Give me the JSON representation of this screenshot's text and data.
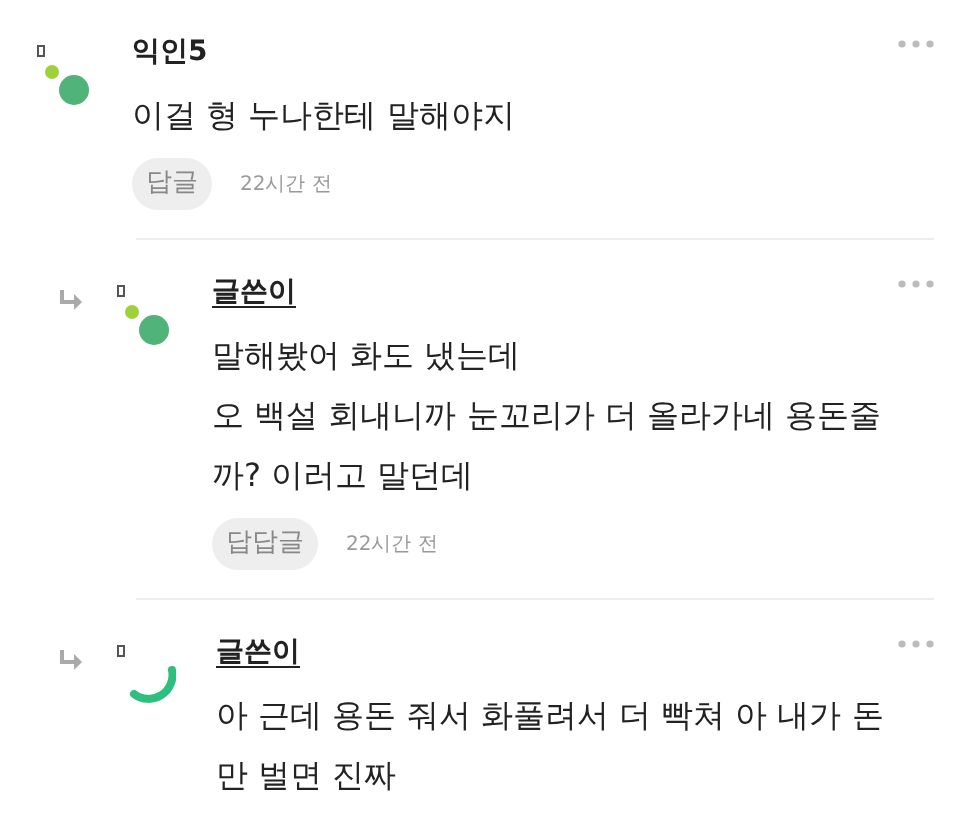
{
  "comments": [
    {
      "is_reply": false,
      "kind": "dots",
      "author": "익인5",
      "underlined": false,
      "lines": [
        "이걸 형 누나한테 말해야지"
      ],
      "reply_button": "답글",
      "time": "22시간 전"
    },
    {
      "is_reply": true,
      "kind": "dots",
      "author": "글쓴이",
      "underlined": true,
      "lines": [
        "말해봤어 화도 냈는데",
        "오 백설 회내니까 눈꼬리가 더 올라가네 용돈줄",
        "까? 이러고 말던데"
      ],
      "reply_button": "답답글",
      "time": "22시간 전"
    },
    {
      "is_reply": true,
      "kind": "arc",
      "author": "글쓴이",
      "underlined": true,
      "lines": [
        "아 근데 용돈 줘서 화풀려서 더 빡쳐 아 내가 돈",
        "만 벌면 진짜"
      ]
    }
  ]
}
